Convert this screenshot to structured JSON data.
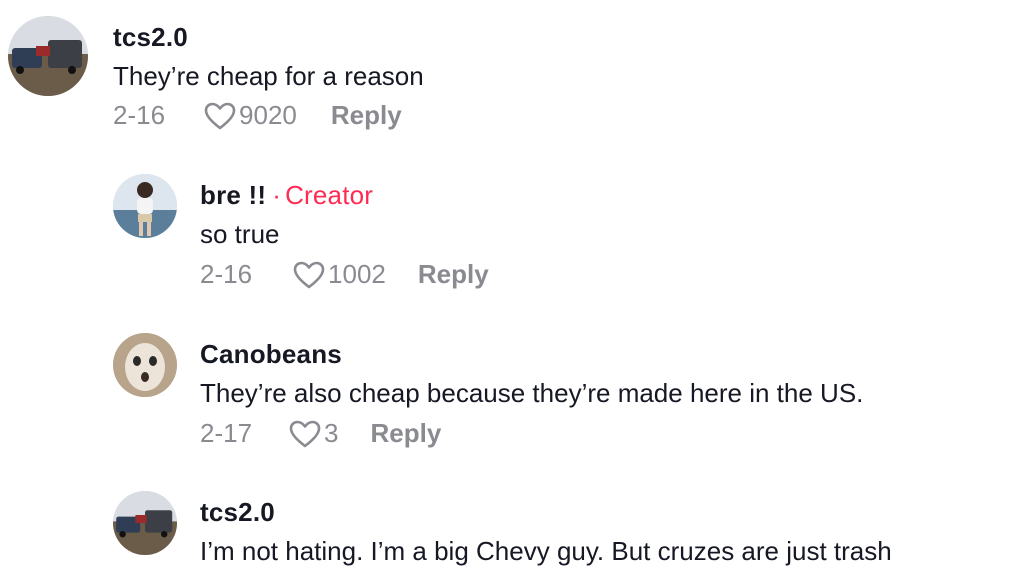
{
  "comments": [
    {
      "username": "tcs2.0",
      "text": "They’re cheap for a reason",
      "date": "2-16",
      "likes": "9020",
      "reply_label": "Reply",
      "avatar_icon": "parking-lot-trucks-avatar"
    },
    {
      "username": "bre !!",
      "badge_separator": "·",
      "badge": "Creator",
      "text": "so true",
      "date": "2-16",
      "likes": "1002",
      "reply_label": "Reply",
      "avatar_icon": "person-avatar"
    },
    {
      "username": "Canobeans",
      "text": "They’re also cheap because they’re made here in the US.",
      "date": "2-17",
      "likes": "3",
      "reply_label": "Reply",
      "avatar_icon": "funny-face-avatar"
    },
    {
      "username": "tcs2.0",
      "text": "I’m not hating. I’m a big Chevy guy. But cruzes are just trash",
      "avatar_icon": "parking-lot-trucks-avatar"
    }
  ],
  "colors": {
    "creator_accent": "#fe2c55",
    "meta_gray": "#8a8b91",
    "text_dark": "#161823"
  }
}
